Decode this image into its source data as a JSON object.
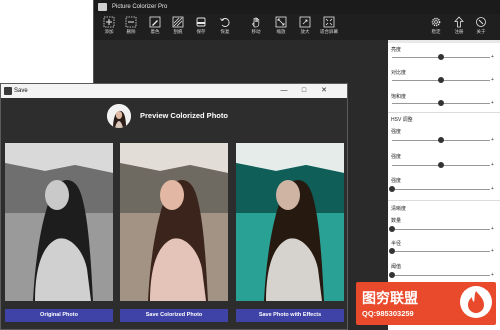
{
  "app": {
    "title": "Picture Colorizer Pro",
    "toolbar_left": [
      {
        "label": "添加",
        "icon": "add-icon"
      },
      {
        "label": "删除",
        "icon": "remove-icon"
      },
      {
        "label": "着色",
        "icon": "colorize-icon"
      },
      {
        "label": "刮痕",
        "icon": "scratch-icon"
      },
      {
        "label": "保存",
        "icon": "save-icon"
      },
      {
        "label": "恢复",
        "icon": "undo-icon"
      },
      {
        "label": "移动",
        "icon": "hand-move-icon"
      },
      {
        "label": "缩放",
        "icon": "zoom-fit-icon"
      },
      {
        "label": "放大",
        "icon": "zoom-in-icon"
      },
      {
        "label": "适合屏幕",
        "icon": "fit-screen-icon"
      }
    ],
    "toolbar_right": [
      {
        "label": "稳定",
        "icon": "gear-icon"
      },
      {
        "label": "注册",
        "icon": "upload-arrow-icon"
      },
      {
        "label": "关于",
        "icon": "about-icon"
      }
    ]
  },
  "panel": {
    "basic_sliders": [
      {
        "label": "亮度",
        "level": 0.5
      },
      {
        "label": "对比度",
        "level": 0.5
      },
      {
        "label": "饱和度",
        "level": 0.5
      }
    ],
    "hsv_title": "HSV 调整",
    "hsv_sliders": [
      {
        "label": "强度",
        "level": 0.5
      },
      {
        "label": "强度",
        "level": 0.5
      },
      {
        "label": "强度",
        "level": 0.0
      }
    ],
    "sharpen_title": "清晰度",
    "sharpen_sliders": [
      {
        "label": "数量",
        "level": 0.0
      },
      {
        "label": "半径",
        "level": 0.0
      },
      {
        "label": "阈值",
        "level": 0.0
      }
    ]
  },
  "dialog": {
    "title": "Save",
    "heading": "Preview Colorized Photo",
    "buttons": {
      "original": "Original Photo",
      "colorized": "Save Colorized Photo",
      "effects": "Save Photo with Effects"
    }
  },
  "watermark": {
    "main": "图穷联盟",
    "qq": "QQ:985303259"
  },
  "colors": {
    "app_bg": "#2b2b2b",
    "toolbar_bg": "#1f1f1f",
    "button_blue": "#3f43a8",
    "watermark_red": "#e84a2b",
    "effects_teal": "#1f8a82"
  }
}
